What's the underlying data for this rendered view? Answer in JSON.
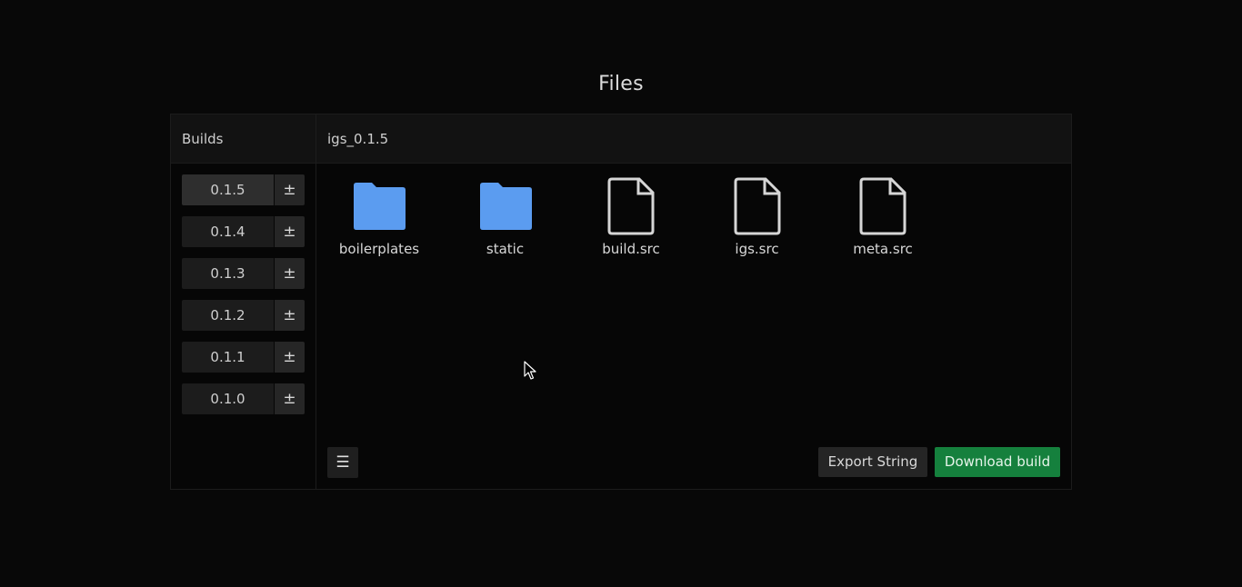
{
  "page": {
    "title": "Files"
  },
  "sidebar": {
    "header": "Builds",
    "builds": [
      {
        "version": "0.1.5",
        "toggle": "±",
        "active": true
      },
      {
        "version": "0.1.4",
        "toggle": "±",
        "active": false
      },
      {
        "version": "0.1.3",
        "toggle": "±",
        "active": false
      },
      {
        "version": "0.1.2",
        "toggle": "±",
        "active": false
      },
      {
        "version": "0.1.1",
        "toggle": "±",
        "active": false
      },
      {
        "version": "0.1.0",
        "toggle": "±",
        "active": false
      }
    ]
  },
  "main": {
    "header": "igs_0.1.5",
    "files": [
      {
        "name": "boilerplates",
        "icon": "folder-icon"
      },
      {
        "name": "static",
        "icon": "folder-icon"
      },
      {
        "name": "build.src",
        "icon": "file-icon"
      },
      {
        "name": "igs.src",
        "icon": "file-icon"
      },
      {
        "name": "meta.src",
        "icon": "file-icon"
      }
    ]
  },
  "footer": {
    "menu_icon": "☰",
    "export_label": "Export String",
    "download_label": "Download build"
  },
  "colors": {
    "background": "#080808",
    "folder": "#5b9cf0",
    "file_outline": "#d6d6d6",
    "download_accent": "#15803d",
    "active_build": "#2e2e2e"
  }
}
